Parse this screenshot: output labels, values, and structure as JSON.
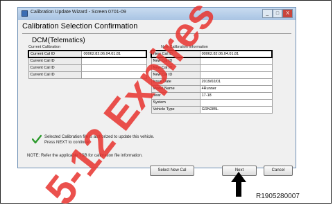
{
  "window": {
    "title": "Calibration Update Wizard - Screen 0701-09",
    "buttons": [
      "_",
      "□",
      "X"
    ]
  },
  "heading": "Calibration Selection Confirmation",
  "module": "DCM(Telematics)",
  "current": {
    "section_label": "Current Calibration",
    "rows": [
      {
        "label": "Current Cal ID",
        "value": "00062.82.06.04.01.81"
      },
      {
        "label": "Current Cal ID",
        "value": ""
      },
      {
        "label": "Current Cal ID",
        "value": ""
      },
      {
        "label": "Current Cal ID",
        "value": ""
      }
    ]
  },
  "new_info": {
    "section_label": "New Calibration Information",
    "rows": [
      {
        "label": "New Cal ID",
        "value": "00062.82.06.04.01.81"
      },
      {
        "label": "New Cal ID",
        "value": ""
      },
      {
        "label": "New Cal ID",
        "value": ""
      },
      {
        "label": "New Cal ID",
        "value": ""
      },
      {
        "label": "Issue Date",
        "value": "2019/02/01"
      },
      {
        "label": "Model Name",
        "value": "4Runner"
      },
      {
        "label": "Year",
        "value": "17-18"
      },
      {
        "label": "System",
        "value": ""
      },
      {
        "label": "Vehicle Type",
        "value": "GRN285L"
      }
    ]
  },
  "message": {
    "line1": "Selected Calibration file is authorized to update this vehicle.",
    "line2": "Press NEXT to continue."
  },
  "note": "NOTE: Refer the applicable TSB for calibration file information.",
  "buttons": {
    "select_new_cal": "Select New Cal",
    "next": "Next",
    "cancel": "Cancel"
  },
  "reference_code": "R1905280007",
  "watermark_text": "5-12 Expires",
  "colors": {
    "titlebar": "#b8d1eb",
    "check": "#2e9b2e",
    "watermark": "#e8322e"
  }
}
